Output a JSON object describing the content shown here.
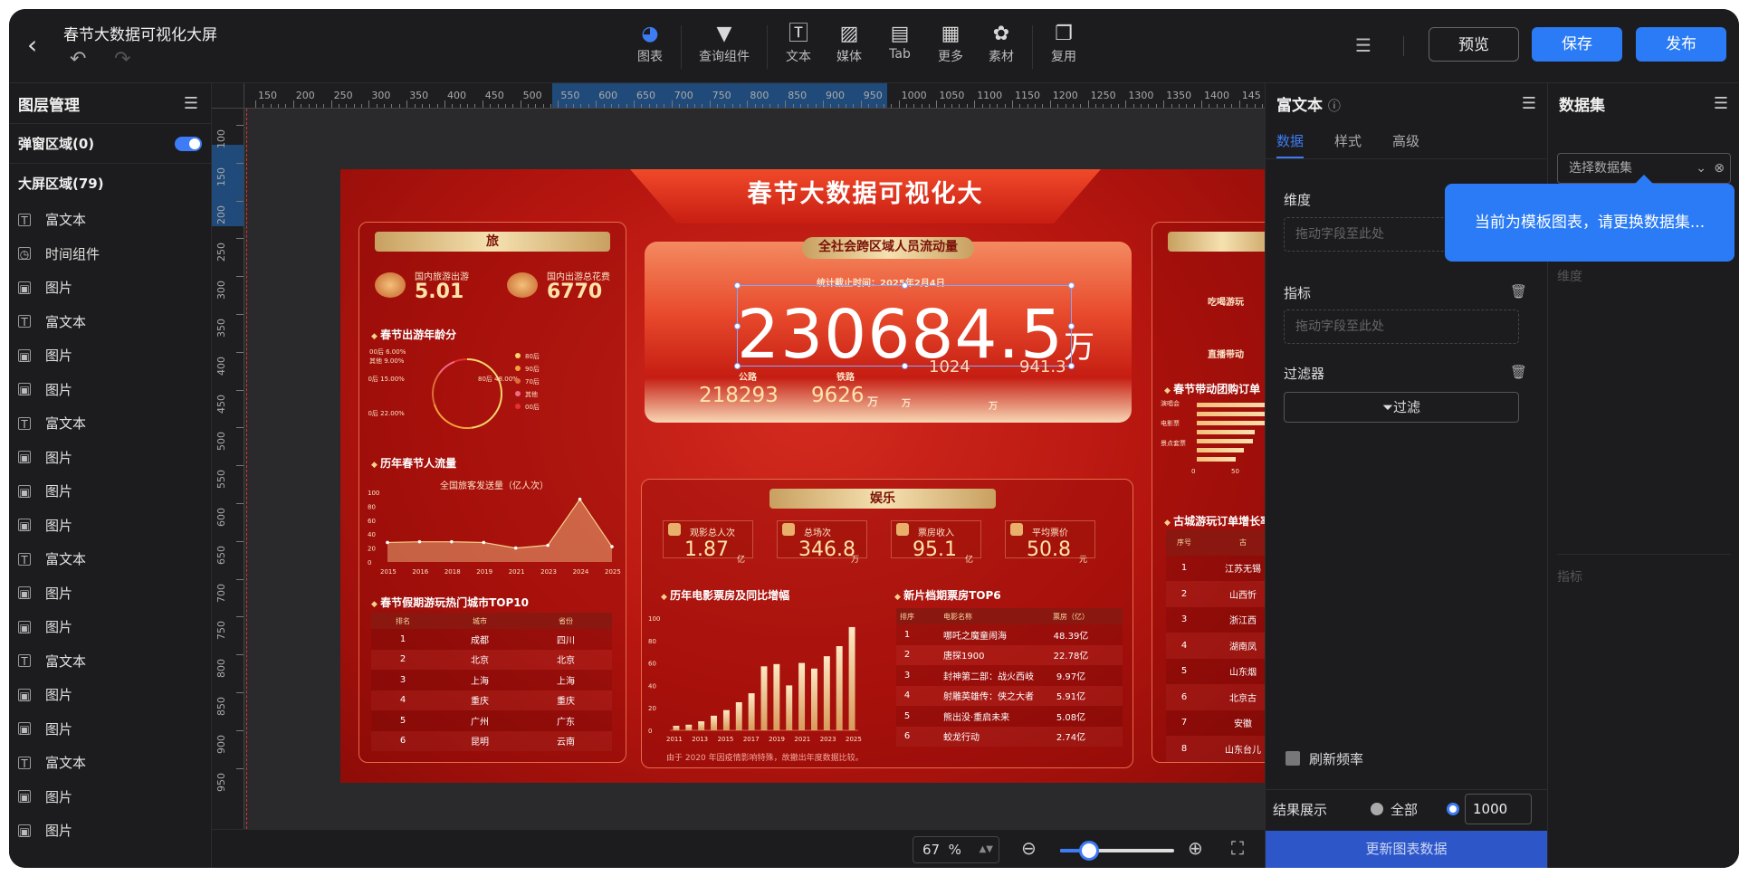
{
  "app": {
    "title": "春节大数据可视化大屏"
  },
  "toolbar": {
    "tools": [
      {
        "label": "图表",
        "icon": "chart-pie-icon"
      },
      {
        "label": "查询组件",
        "icon": "filter-icon"
      },
      {
        "label": "文本",
        "icon": "text-icon"
      },
      {
        "label": "媒体",
        "icon": "image-icon"
      },
      {
        "label": "Tab",
        "icon": "tab-icon"
      },
      {
        "label": "更多",
        "icon": "grid-icon"
      },
      {
        "label": "素材",
        "icon": "palette-icon"
      },
      {
        "label": "复用",
        "icon": "copy-icon"
      }
    ],
    "preview": "预览",
    "save": "保存",
    "publish": "发布"
  },
  "layers": {
    "header": "图层管理",
    "popup_section": "弹窗区域(0)",
    "screen_section": "大屏区域(79)",
    "items": [
      {
        "label": "富文本",
        "icon": "T"
      },
      {
        "label": "时间组件",
        "icon": "◷"
      },
      {
        "label": "图片",
        "icon": "▣"
      },
      {
        "label": "富文本",
        "icon": "T"
      },
      {
        "label": "图片",
        "icon": "▣"
      },
      {
        "label": "图片",
        "icon": "▣"
      },
      {
        "label": "富文本",
        "icon": "T"
      },
      {
        "label": "图片",
        "icon": "▣"
      },
      {
        "label": "图片",
        "icon": "▣"
      },
      {
        "label": "图片",
        "icon": "▣"
      },
      {
        "label": "富文本",
        "icon": "T"
      },
      {
        "label": "图片",
        "icon": "▣"
      },
      {
        "label": "图片",
        "icon": "▣"
      },
      {
        "label": "富文本",
        "icon": "T"
      },
      {
        "label": "图片",
        "icon": "▣"
      },
      {
        "label": "图片",
        "icon": "▣"
      },
      {
        "label": "富文本",
        "icon": "T"
      },
      {
        "label": "图片",
        "icon": "▣"
      },
      {
        "label": "图片",
        "icon": "▣"
      }
    ]
  },
  "ruler": {
    "h_labels": [
      "150",
      "200",
      "250",
      "300",
      "350",
      "400",
      "450",
      "500",
      "550",
      "600",
      "650",
      "700",
      "750",
      "800",
      "850",
      "900",
      "950",
      "1000",
      "1050",
      "1100",
      "1150",
      "1200",
      "1250",
      "1300",
      "1350",
      "1400",
      "145"
    ],
    "v_labels": [
      "100",
      "150",
      "200",
      "250",
      "300",
      "350",
      "400",
      "450",
      "500",
      "550",
      "600",
      "650",
      "700",
      "750",
      "800",
      "850",
      "900",
      "950"
    ]
  },
  "zoom": {
    "value": "67",
    "unit": "%",
    "level": 0.25
  },
  "dashboard": {
    "title": "春节大数据可视化大",
    "left_panel_title": "旅",
    "travel_label_1": "国内旅游出游",
    "travel_value_1": "5.01",
    "travel_label_2": "国内出游总花费",
    "travel_value_2": "6770",
    "age_title": "春节出游年龄分",
    "age_labels": [
      "00后 6.00%",
      "其他 9.00%",
      "70后 15.00%",
      "80后 48.00%",
      "90后 22.00%"
    ],
    "age_legend": [
      "80后",
      "90后",
      "70后",
      "其他",
      "00后"
    ],
    "flow_title": "历年春节人流量",
    "flow_legend": "全国旅客发送量（亿人次）",
    "flow_x": [
      "2015",
      "2016",
      "2018",
      "2019",
      "2021",
      "2023",
      "2024",
      "2025"
    ],
    "flow_y": [
      "100",
      "80",
      "60",
      "40",
      "20",
      "0"
    ],
    "city_title": "春节假期游玩热门城市TOP10",
    "city_headers": [
      "排名",
      "城市",
      "省份"
    ],
    "city_rows": [
      [
        "1",
        "成都",
        "四川"
      ],
      [
        "2",
        "北京",
        "北京"
      ],
      [
        "3",
        "上海",
        "上海"
      ],
      [
        "4",
        "重庆",
        "重庆"
      ],
      [
        "5",
        "广州",
        "广东"
      ],
      [
        "6",
        "昆明",
        "云南"
      ]
    ],
    "center_title": "全社会跨区域人员流动量",
    "center_date": "统计截止时间：2025年2月4日",
    "center_big": "230684.5",
    "center_big_unit": "万",
    "center_sub_labels": [
      "公路",
      "铁路"
    ],
    "center_sub_values": [
      "218293",
      "9626"
    ],
    "center_sub_units": [
      "万",
      "万",
      "万"
    ],
    "center_hidden_values": [
      "1024",
      "941.3"
    ],
    "ent_title": "娱乐",
    "ent_kpis": [
      {
        "label": "观影总人次",
        "value": "1.87",
        "unit": "亿"
      },
      {
        "label": "总场次",
        "value": "346.8",
        "unit": "万"
      },
      {
        "label": "票房收入",
        "value": "95.1",
        "unit": "亿"
      },
      {
        "label": "平均票价",
        "value": "50.8",
        "unit": "元"
      }
    ],
    "box_title": "历年电影票房及同比增幅",
    "box_note": "由于 2020 年因疫情影响特殊，故撤出年度数据比较。",
    "box_y": [
      "100",
      "80",
      "60",
      "40",
      "20",
      "0"
    ],
    "box_x": [
      "2011",
      "2013",
      "2015",
      "2017",
      "2019",
      "2021",
      "2023",
      "2025"
    ],
    "movie_title": "新片档期票房TOP6",
    "movie_headers": [
      "排序",
      "电影名称",
      "票房（亿）"
    ],
    "movie_rows": [
      [
        "1",
        "哪吒之魔童闹海",
        "48.39亿"
      ],
      [
        "2",
        "唐探1900",
        "22.78亿"
      ],
      [
        "3",
        "封神第二部：战火西岐",
        "9.97亿"
      ],
      [
        "4",
        "射雕英雄传：侠之大者",
        "5.91亿"
      ],
      [
        "5",
        "熊出没·重启未来",
        "5.08亿"
      ],
      [
        "6",
        "蛟龙行动",
        "2.74亿"
      ]
    ],
    "right_labels": [
      "吃喝游玩",
      "直播带动",
      ""
    ],
    "right_order_title": "春节带动团购订单",
    "right_bar_labels": [
      "演唱会",
      "电影票",
      "景点套票"
    ],
    "right_bar_vals": [
      "71",
      "69",
      "58",
      "48"
    ],
    "right_axis": [
      "0",
      "50"
    ],
    "right_table_title": "古城游玩订单增长率",
    "right_table_header": [
      "序号",
      "古"
    ],
    "right_table_rows": [
      [
        "1",
        "江苏无锡"
      ],
      [
        "2",
        "山西忻"
      ],
      [
        "3",
        "浙江西"
      ],
      [
        "4",
        "湖南凤"
      ],
      [
        "5",
        "山东烟"
      ],
      [
        "6",
        "北京古"
      ],
      [
        "7",
        "安徽"
      ],
      [
        "8",
        "山东台儿"
      ]
    ]
  },
  "chart_data": [
    {
      "type": "pie",
      "title": "春节出游年龄分",
      "categories": [
        "80后",
        "90后",
        "70后",
        "其他",
        "00后"
      ],
      "values": [
        48,
        22,
        15,
        9,
        6
      ]
    },
    {
      "type": "area",
      "title": "历年春节人流量",
      "categories": [
        "2015",
        "2016",
        "2018",
        "2019",
        "2021",
        "2023",
        "2024",
        "2025"
      ],
      "series": [
        {
          "name": "全国旅客发送量（亿人次）",
          "values": [
            28,
            29,
            29,
            28,
            20,
            24,
            90,
            22
          ]
        }
      ],
      "ylim": [
        0,
        100
      ]
    },
    {
      "type": "bar",
      "title": "历年电影票房及同比增幅",
      "categories": [
        "2011",
        "2012",
        "2013",
        "2014",
        "2015",
        "2016",
        "2017",
        "2018",
        "2019",
        "2020",
        "2021",
        "2022",
        "2023",
        "2024",
        "2025"
      ],
      "values": [
        4,
        5,
        8,
        13,
        18,
        25,
        33,
        57,
        59,
        40,
        60,
        55,
        66,
        75,
        92
      ],
      "ylim": [
        0,
        100
      ]
    }
  ],
  "props": {
    "header": "富文本",
    "tabs": [
      "数据",
      "样式",
      "高级"
    ],
    "dimension_label": "维度",
    "dimension_placeholder": "拖动字段至此处",
    "metric_label": "指标",
    "metric_placeholder": "拖动字段至此处",
    "filter_label": "过滤器",
    "filter_button": "过滤",
    "refresh_label": "刷新频率",
    "result_label": "结果展示",
    "result_all": "全部",
    "result_value": "1000",
    "update_button": "更新图表数据"
  },
  "dataset": {
    "header": "数据集",
    "placeholder": "选择数据集",
    "tooltip": "当前为模板图表，请更换数据集...",
    "dim_label": "维度",
    "metric_label": "指标"
  },
  "colors": {
    "accent": "#3d7cf5",
    "panel_bg": "#1c1c1e",
    "dash_red": "#b5150f"
  }
}
